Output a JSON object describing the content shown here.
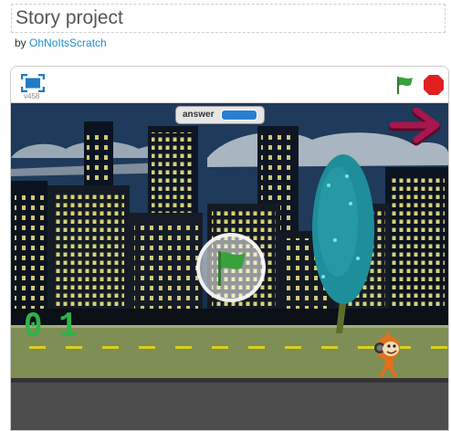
{
  "project": {
    "title": "Story project",
    "by_prefix": "by",
    "author": "OhNoItsScratch"
  },
  "player": {
    "version": "v458",
    "fullscreen_icon": "fullscreen-icon",
    "flag_icon": "green-flag-icon",
    "stop_icon": "stop-sign-icon"
  },
  "stage": {
    "answer_monitor": {
      "label": "answer",
      "value": ""
    },
    "counter_text": "01",
    "next_arrow_icon": "right-arrow-icon",
    "colors": {
      "sky": "#1f3a5a",
      "road": "#7f8e54",
      "road_dash": "#d8d020",
      "flag": "#37a23b",
      "counter": "#2fb34a",
      "arrow": "#a8164f",
      "stop": "#e02020"
    }
  }
}
